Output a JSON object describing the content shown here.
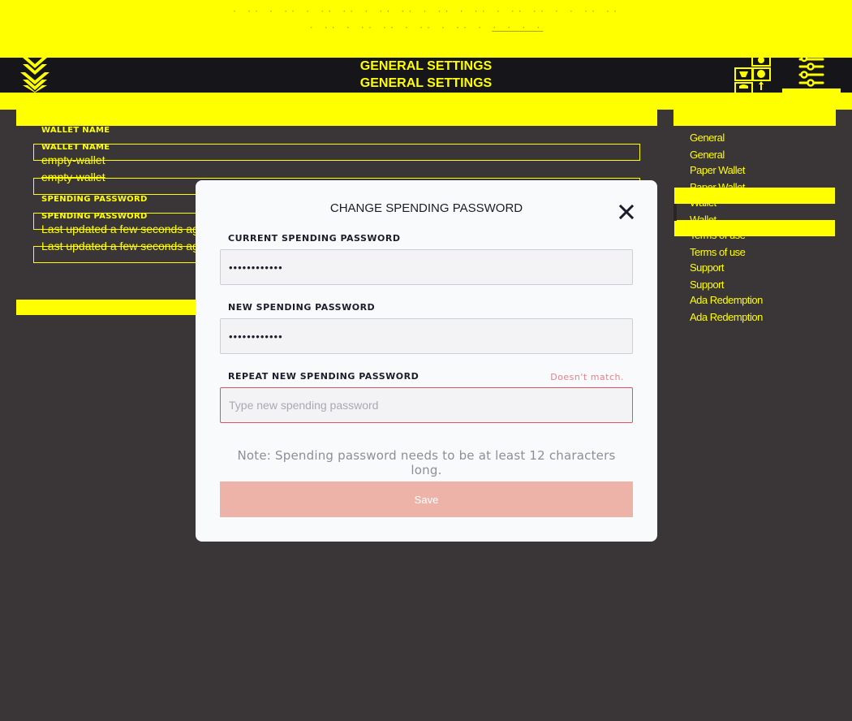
{
  "banner": {
    "line1": "· ·· · ·· · ·· ·· · ·· ·· · ·· · ·· · ·· ·· · · ·· ··",
    "line2": "· ·· · ·· ·· · ·· · ·· ·",
    "link_label": "· · · ·"
  },
  "header": {
    "title": "GENERAL SETTINGS",
    "title_duplicate": "GENERAL SETTINGS",
    "icons": [
      "logo-icon",
      "wallets-icon",
      "settings-icon"
    ]
  },
  "content": {
    "wallet_name": {
      "label": "WALLET NAME",
      "label_duplicate": "WALLET NAME",
      "value": "empty-wallet",
      "value_duplicate": "empty-wallet"
    },
    "spending_password": {
      "label": "SPENDING PASSWORD",
      "label_duplicate": "SPENDING PASSWORD",
      "value": "Last updated a few seconds ago",
      "value_duplicate": "Last updated a few seconds ago"
    }
  },
  "sidebar": {
    "items": [
      {
        "label": "General",
        "selected": false
      },
      {
        "label": "General",
        "selected": false
      },
      {
        "label": "Paper Wallet",
        "selected": false
      },
      {
        "label": "Paper Wallet",
        "selected": false
      },
      {
        "label": "Wallet",
        "selected": true
      },
      {
        "label": "Wallet",
        "selected": true
      },
      {
        "label": "Terms of use",
        "selected": false
      },
      {
        "label": "Terms of use",
        "selected": false
      },
      {
        "label": "Support",
        "selected": false
      },
      {
        "label": "Support",
        "selected": false
      },
      {
        "label": "Ada Redemption",
        "selected": false
      },
      {
        "label": "Ada Redemption",
        "selected": false
      }
    ]
  },
  "modal": {
    "title": "CHANGE SPENDING PASSWORD",
    "current_password": {
      "label": "CURRENT SPENDING PASSWORD",
      "value": "••••••••••••"
    },
    "new_password": {
      "label": "NEW SPENDING PASSWORD",
      "value": "••••••••••••"
    },
    "repeat_password": {
      "label": "REPEAT NEW SPENDING PASSWORD",
      "value": "",
      "placeholder": "Type new spending password",
      "error": "Doesn't match."
    },
    "note": "Note: Spending password needs to be at least 12 characters long.",
    "save_label": "Save"
  },
  "colors": {
    "accent_yellow": "#ffff00",
    "topbar": "#161519",
    "background": "#3a3536",
    "modal_bg": "#f9fafc",
    "error": "#e2515f",
    "save_disabled": "#edb2a8"
  }
}
